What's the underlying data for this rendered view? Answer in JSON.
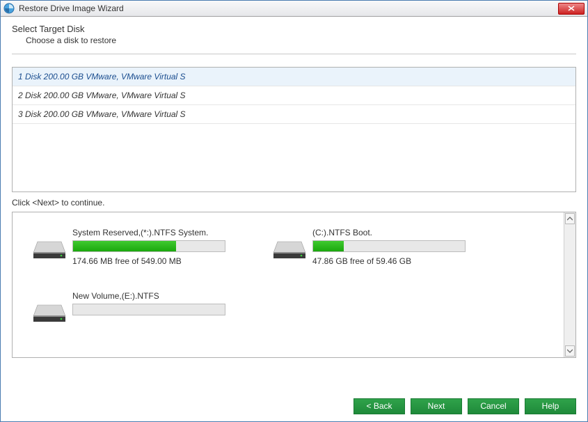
{
  "window": {
    "title": "Restore Drive Image Wizard"
  },
  "header": {
    "heading": "Select Target Disk",
    "sub": "Choose a disk to restore"
  },
  "disks": [
    {
      "label": "1 Disk 200.00 GB VMware,  VMware Virtual S",
      "selected": true
    },
    {
      "label": "2 Disk 200.00 GB VMware,  VMware Virtual S",
      "selected": false
    },
    {
      "label": "3 Disk 200.00 GB VMware,  VMware Virtual S",
      "selected": false
    }
  ],
  "continue_text": "Click <Next> to continue.",
  "partitions": [
    {
      "title": "System Reserved,(*:).NTFS System.",
      "free_text": "174.66 MB free of 549.00 MB",
      "used_pct": 68
    },
    {
      "title": "(C:).NTFS Boot.",
      "free_text": "47.86 GB free of 59.46 GB",
      "used_pct": 20
    },
    {
      "title": "New Volume,(E:).NTFS",
      "free_text": "",
      "used_pct": 0
    }
  ],
  "buttons": {
    "back": "< Back",
    "next": "Next",
    "cancel": "Cancel",
    "help": "Help"
  }
}
